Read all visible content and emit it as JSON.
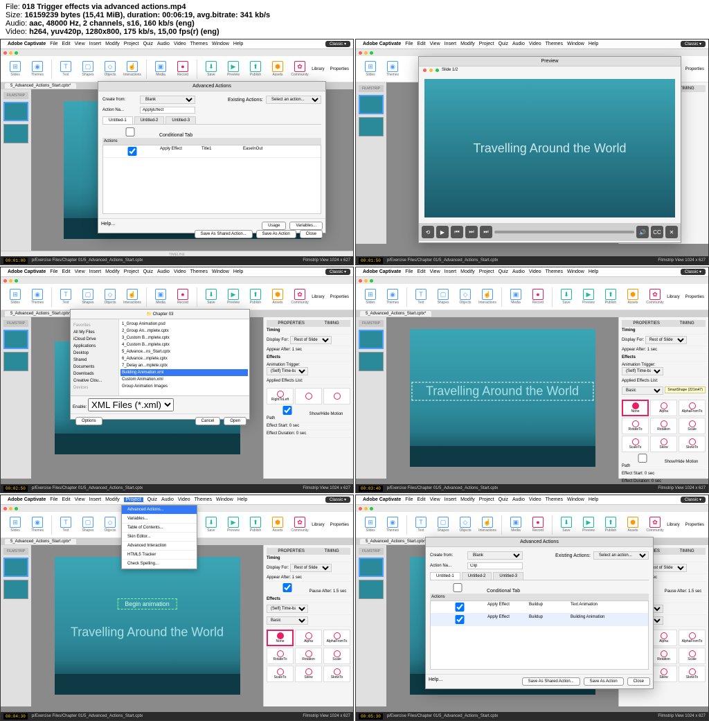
{
  "header": {
    "file_label": "File:",
    "file": "018 Trigger effects via advanced actions.mp4",
    "size_label": "Size:",
    "size": "16159239 bytes (15,41 MiB), duration: 00:06:19, avg.bitrate: 341 kb/s",
    "audio_label": "Audio:",
    "audio": "aac, 48000 Hz, 2 channels, s16, 160 kb/s (eng)",
    "video_label": "Video:",
    "video": "h264, yuv420p, 1280x800, 175 kb/s, 15,00 fps(r) (eng)"
  },
  "common": {
    "app_name": "Adobe Captivate",
    "menus": [
      "File",
      "Edit",
      "View",
      "Insert",
      "Modify",
      "Project",
      "Quiz",
      "Audio",
      "Video",
      "Themes",
      "Window",
      "Help"
    ],
    "classic": "Classic ▾",
    "toolbar": [
      {
        "label": "Slides",
        "color": "b"
      },
      {
        "label": "Themes",
        "color": "b"
      },
      {
        "label": "",
        "color": ""
      },
      {
        "label": "Text",
        "color": "b"
      },
      {
        "label": "Shapes",
        "color": "b"
      },
      {
        "label": "Objects",
        "color": "b"
      },
      {
        "label": "Interactions",
        "color": "b"
      },
      {
        "label": "",
        "color": ""
      },
      {
        "label": "Media",
        "color": "b"
      },
      {
        "label": "Record",
        "color": "p"
      },
      {
        "label": "",
        "color": ""
      },
      {
        "label": "Save",
        "color": "g"
      },
      {
        "label": "Preview",
        "color": "g"
      },
      {
        "label": "Publish",
        "color": "g"
      },
      {
        "label": "Assets",
        "color": "o"
      },
      {
        "label": "Community",
        "color": "p"
      }
    ],
    "right_tabs": [
      "Library",
      "Properties"
    ],
    "filmstrip": "FILMSTRIP",
    "tab_name": "5_Advanced_Actions_Start.cptx*",
    "timeline": "TIMELINE",
    "slide_title": "Travelling Around the World",
    "bottom_path": "p/Exercise Files/Chapter 01/5_Advanced_Actions_Start.cptx",
    "bottom_right": "Filmstrip View    1024 x 627"
  },
  "props_panel": {
    "tabs": [
      "PROPERTIES",
      "TIMING"
    ],
    "timing": "Timing",
    "display_for": "Display For:",
    "rest_slide": "Rest of Slide",
    "appear_after": "Appear After:",
    "appear_val": "1 sec",
    "pause_after": "Pause After:",
    "pause_val": "1.5 sec",
    "effects": "Effects",
    "anim_trigger": "Animation Trigger:",
    "trigger_val": "(Self) Time-based animation",
    "applied_fx": "Applied Effects List:",
    "basic": "Basic",
    "fx_items": [
      "None",
      "Alpha",
      "AlphaFromTo",
      "RotateTo",
      "Rotation",
      "Scale",
      "ScaleTo",
      "Skew",
      "SkewTo"
    ],
    "show_motion": "Show/Hide Motion Path",
    "eff_start": "Effect Start:",
    "eff_dur": "Effect Duration:",
    "zero": "0 sec"
  },
  "adv_dialog": {
    "title": "Advanced Actions",
    "create_from": "Create from:",
    "blank": "Blank",
    "action_name": "Action Na...",
    "apply_effect_val": "ApplyEffect",
    "existing": "Existing Actions:",
    "select_action": "Select an action...",
    "tabs": [
      "Untitled-1",
      "Untitled-2",
      "Untitled-3"
    ],
    "cond_tab": "Conditional Tab",
    "actions_hdr": "Actions",
    "cols": [
      "",
      "Apply Effect",
      "Title1",
      "EaseInOut"
    ],
    "cols6": [
      "",
      "Apply Effect",
      "Buildup",
      "Text Animation"
    ],
    "cols6b": [
      "",
      "Apply Effect",
      "Buildup",
      "Building Animation"
    ],
    "help": "Help...",
    "btns": [
      "Save As Shared Action...",
      "Save As Action",
      "Close"
    ],
    "usage": "Usage",
    "variables": "Variables..."
  },
  "preview": {
    "title": "Preview",
    "slide_info": "Slide 1/2"
  },
  "file_dialog": {
    "sidebar_hdr": "Favorites",
    "sidebar": [
      "All My Files",
      "iCloud Drive",
      "Applications",
      "Desktop",
      "Shared",
      "Documents",
      "Downloads",
      "Creative Clou..."
    ],
    "devices": "Devices",
    "enable": "Enable:",
    "xml": "XML Files (*.xml)",
    "folder": "Chapter 03",
    "files": [
      "1_Group Animation.psd",
      "2_Group An...mplete.cptx",
      "3_Custom B...mplete.cptx",
      "4_Custom B...mplete.cptx",
      "5_Advance...ns_Start.cptx",
      "6_Advance...mplete.cptx",
      "7_Delay an...mplete.cptx",
      "Building Animation.xml",
      "Custom Animation.xml",
      "Group Animation Images"
    ],
    "selected": "Building Animation.xml",
    "options": "Options",
    "cancel": "Cancel",
    "open": "Open"
  },
  "proj_menu": {
    "items": [
      "Advanced Actions...",
      "Variables...",
      "Table of Contents...",
      "Skin Editor...",
      "Advanced Interaction",
      "HTML5 Tracker",
      "Check Spelling..."
    ],
    "highlighted": "Advanced Actions...",
    "shortcut": "⇧⌘"
  },
  "thumb4": {
    "tooltip": "SmartShape (221m47)"
  },
  "begin_anim": "Begin animation",
  "timestamps": [
    "00:01:00",
    "00:01:50",
    "00:02:50",
    "00:03:40",
    "00:04:30",
    "00:05:30"
  ]
}
